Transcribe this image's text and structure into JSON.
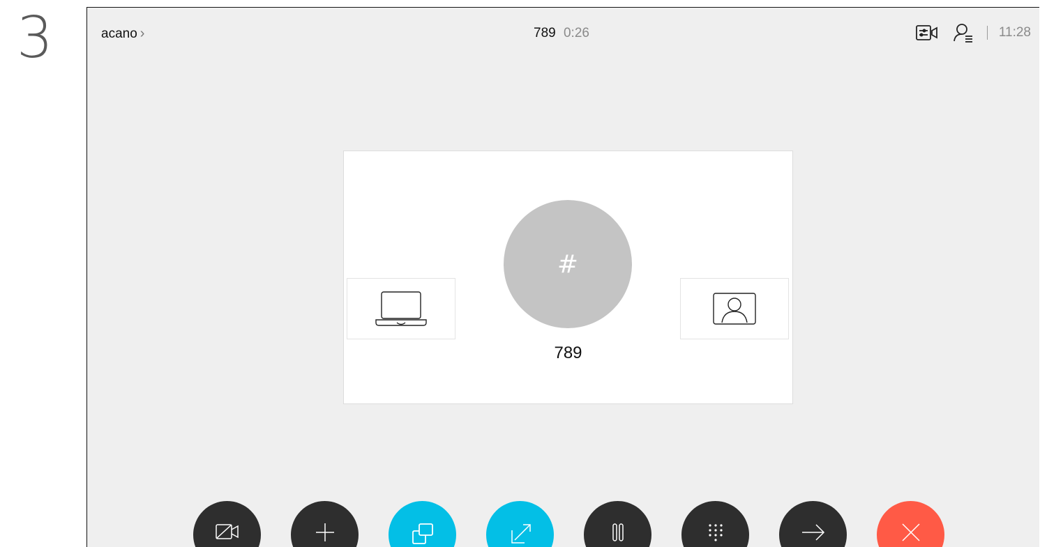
{
  "step": {
    "number": "3"
  },
  "header": {
    "breadcrumb": "acano",
    "call_number": "789",
    "call_duration": "0:26",
    "time": "11:28",
    "icons": [
      "camera-settings-icon",
      "participants-icon"
    ]
  },
  "stage": {
    "avatar_glyph": "#",
    "participant_name": "789",
    "left_tile_icon": "laptop-icon",
    "right_tile_icon": "self-view-icon"
  },
  "controls": [
    {
      "name": "camera-off-button",
      "icon": "camera-off-icon",
      "color": "#2e2e2e"
    },
    {
      "name": "add-participant-button",
      "icon": "plus-icon",
      "color": "#2e2e2e"
    },
    {
      "name": "share-button",
      "icon": "share-screen-icon",
      "color": "#03bfe6"
    },
    {
      "name": "layout-button",
      "icon": "expand-icon",
      "color": "#03bfe6"
    },
    {
      "name": "hold-button",
      "icon": "pause-icon",
      "color": "#2e2e2e"
    },
    {
      "name": "keypad-button",
      "icon": "keypad-icon",
      "color": "#2e2e2e"
    },
    {
      "name": "transfer-button",
      "icon": "arrow-right-icon",
      "color": "#2e2e2e"
    },
    {
      "name": "end-call-button",
      "icon": "close-icon",
      "color": "#ff5a46"
    }
  ],
  "colors": {
    "background": "#efefef",
    "accent": "#03bfe6",
    "end_call": "#ff5a46"
  }
}
